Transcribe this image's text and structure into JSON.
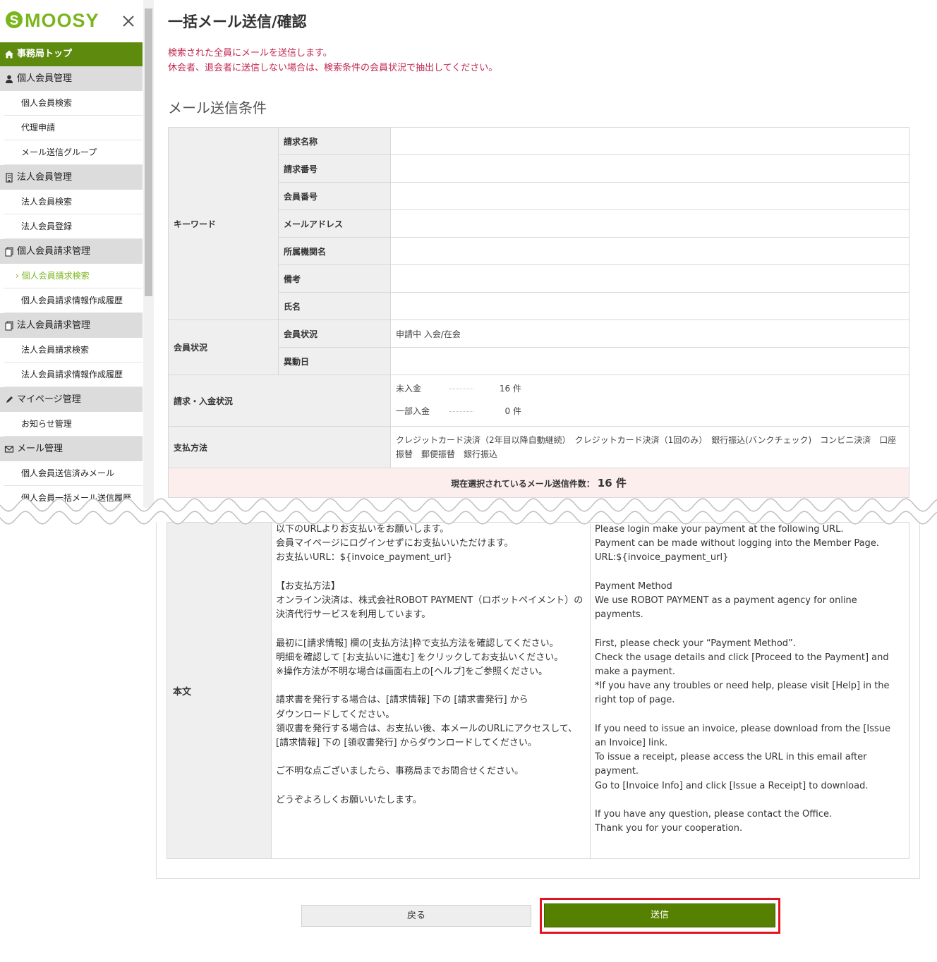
{
  "sidebar": {
    "logo": "SMOOSY",
    "top": "事務局トップ",
    "sections": [
      {
        "title": "個人会員管理",
        "icon": "person-icon",
        "items": [
          "個人会員検索",
          "代理申請",
          "メール送信グループ"
        ]
      },
      {
        "title": "法人会員管理",
        "icon": "building-icon",
        "items": [
          "法人会員検索",
          "法人会員登録"
        ]
      },
      {
        "title": "個人会員請求管理",
        "icon": "document-icon",
        "items": [
          "個人会員請求検索",
          "個人会員請求情報作成履歴"
        ]
      },
      {
        "title": "法人会員請求管理",
        "icon": "document-icon",
        "items": [
          "法人会員請求検索",
          "法人会員請求情報作成履歴"
        ]
      },
      {
        "title": "マイページ管理",
        "icon": "pencil-icon",
        "items": [
          "お知らせ管理"
        ]
      },
      {
        "title": "メール管理",
        "icon": "mail-icon",
        "items": [
          "個人会員送信済みメール",
          "個人会員一括メール送信履歴"
        ]
      }
    ],
    "active_item": "個人会員請求検索"
  },
  "page": {
    "title": "一括メール送信/確認",
    "notice_line1": "検索された全員にメールを送信します。",
    "notice_line2": "休会者、退会者に送信しない場合は、検索条件の会員状況で抽出してください。",
    "section_title": "メール送信条件"
  },
  "conditions": {
    "keyword_label": "キーワード",
    "keyword_fields": [
      {
        "label": "請求名称",
        "value": ""
      },
      {
        "label": "請求番号",
        "value": ""
      },
      {
        "label": "会員番号",
        "value": ""
      },
      {
        "label": "メールアドレス",
        "value": ""
      },
      {
        "label": "所属機関名",
        "value": ""
      },
      {
        "label": "備考",
        "value": ""
      },
      {
        "label": "氏名",
        "value": ""
      }
    ],
    "member_status_label": "会員状況",
    "member_status_sub": "会員状況",
    "member_status_value": "申請中 入会/在会",
    "change_date_label": "異動日",
    "change_date_value": "",
    "payment_status_label": "請求・入金状況",
    "unpaid_label": "未入金",
    "unpaid_count": "16 件",
    "partial_label": "一部入金",
    "partial_count": "0 件",
    "method_label": "支払方法",
    "method_value": "クレジットカード決済（2年目以降自動継続）　クレジットカード決済（1回のみ）　銀行振込(バンクチェック)　コンビニ決済　口座振替　郵便振替　銀行振込",
    "count_label": "現在選択されているメール送信件数：",
    "count_value": "16 件"
  },
  "mail": {
    "body_label": "本文",
    "jp_text": "以下のURLよりお支払いをお願いします。\n会員マイページにログインせずにお支払いいただけます。\nお支払いURL：${invoice_payment_url}\n\n【お支払方法】\nオンライン決済は、株式会社ROBOT PAYMENT（ロボットペイメント）の決済代行サービスを利用しています。\n\n最初に[請求情報] 欄の[支払方法]枠で支払方法を確認してください。\n明細を確認して [お支払いに進む] をクリックしてお支払いください。\n※操作方法が不明な場合は画面右上の[ヘルプ]をご参照ください。\n\n請求書を発行する場合は、[請求情報] 下の [請求書発行] から\nダウンロードしてください。\n領収書を発行する場合は、お支払い後、本メールのURLにアクセスして、\n[請求情報] 下の [領収書発行] からダウンロードしてください。\n\nご不明な点ございましたら、事務局までお問合せください。\n\nどうぞよろしくお願いいたします。",
    "en_text": "Please login make your payment at the following URL.\nPayment can be made without logging into the Member Page.\nURL:${invoice_payment_url}\n\nPayment Method\nWe use ROBOT PAYMENT as a payment agency for online payments.\n\nFirst, please check your “Payment Method”.\nCheck the usage details and click [Proceed to the Payment] and make a payment.\n*If you have any troubles or need help, please visit [Help] in the right top of page.\n\nIf you need to issue an invoice, please download from the [Issue an Invoice] link.\nTo issue a receipt, please access the URL in this email after payment.\nGo to [Invoice Info] and click [Issue a Receipt] to download.\n\nIf you have any question, please contact the Office.\nThank you for your cooperation."
  },
  "buttons": {
    "back": "戻る",
    "send": "送信"
  },
  "colors": {
    "accent_green": "#5e8b0e",
    "send_button": "#558000",
    "notice_red": "#c0254e",
    "highlight_red": "#e0161f"
  }
}
